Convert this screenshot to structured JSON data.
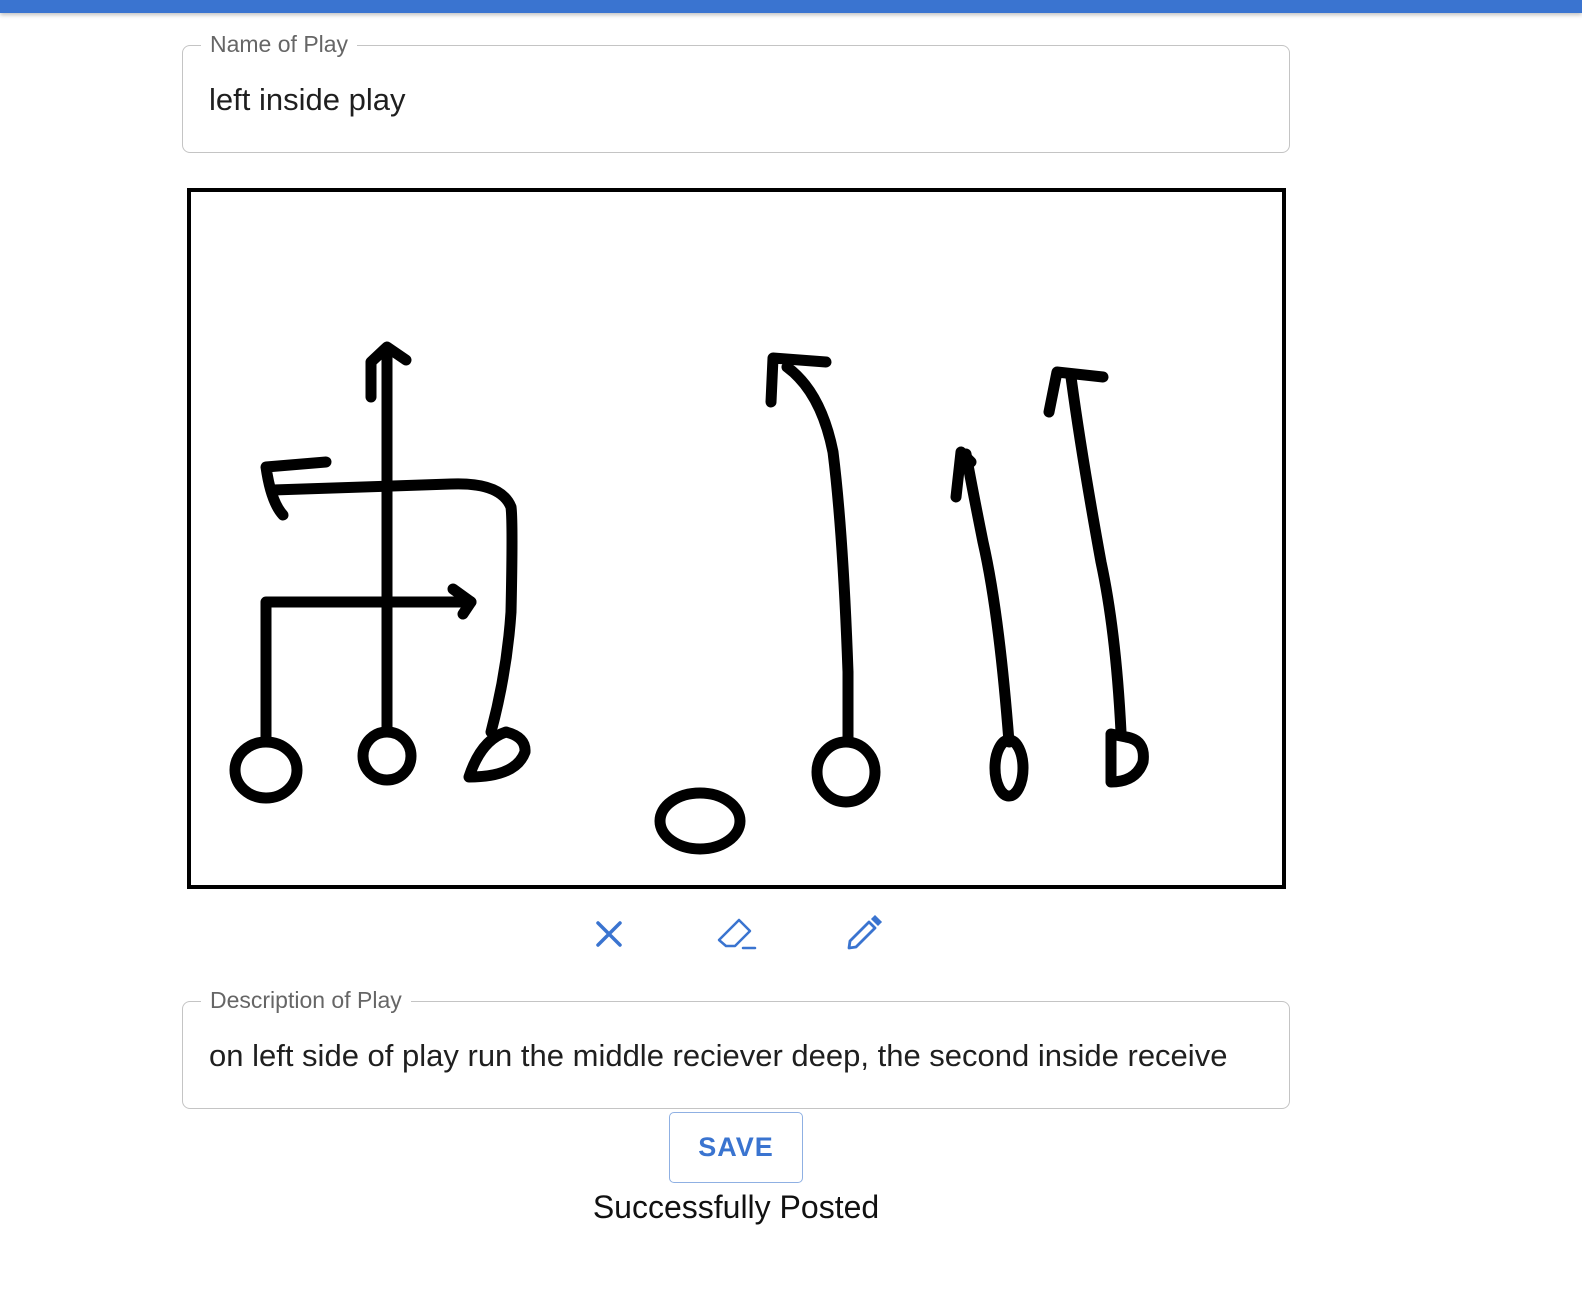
{
  "name_field": {
    "label": "Name of Play",
    "value": "left inside play"
  },
  "drawing": {
    "stroke_color": "#000000"
  },
  "toolbar": {
    "clear_icon": "close-icon",
    "eraser_icon": "eraser-icon",
    "pen_icon": "pencil-icon",
    "icon_color": "#3a74d0"
  },
  "description_field": {
    "label": "Description of Play",
    "value": "on left side of play run the middle reciever deep, the second inside receive"
  },
  "save_button": {
    "label": "SAVE"
  },
  "status": {
    "message": "Successfully Posted"
  },
  "colors": {
    "accent": "#3a74d0"
  }
}
